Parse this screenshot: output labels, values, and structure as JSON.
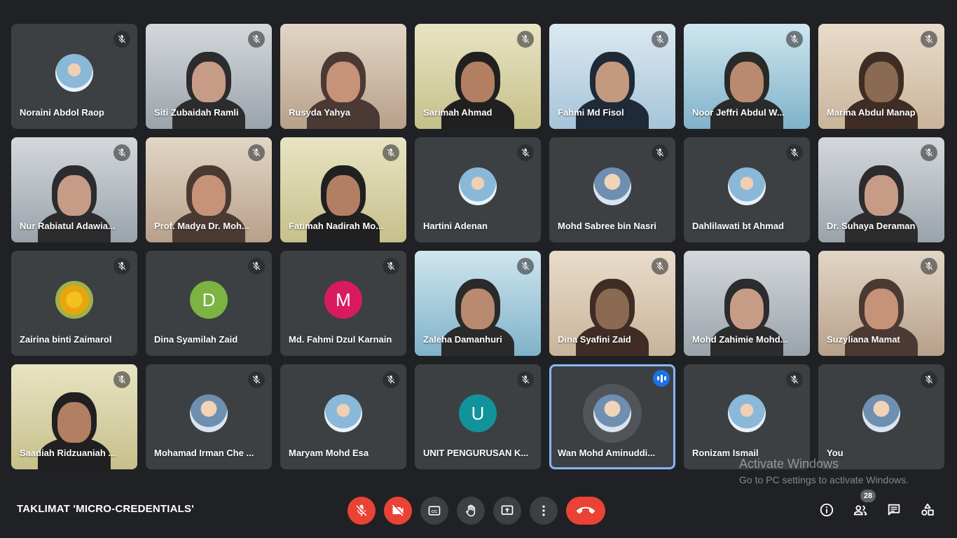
{
  "meeting": {
    "title": "TAKLIMAT 'MICRO-CREDENTIALS'",
    "participant_count": "28"
  },
  "watermark": {
    "line1": "Activate Windows",
    "line2": "Go to PC settings to activate Windows."
  },
  "participants": [
    {
      "name": "Noraini Abdol Raop",
      "tile": "avatar",
      "avatar": "photo-hijab",
      "muted": true
    },
    {
      "name": "Siti Zubaidah Ramli",
      "tile": "video",
      "muted": true
    },
    {
      "name": "Rusyda Yahya",
      "tile": "video",
      "muted": false
    },
    {
      "name": "Sarimah Ahmad",
      "tile": "video",
      "muted": true
    },
    {
      "name": "Fahmi Md Fisol",
      "tile": "video",
      "muted": true
    },
    {
      "name": "Noor Jeffri Abdul W...",
      "tile": "video",
      "muted": true
    },
    {
      "name": "Marina Abdul Manap",
      "tile": "video",
      "muted": true
    },
    {
      "name": "Nur Rabiatul Adawia...",
      "tile": "video",
      "muted": true
    },
    {
      "name": "Prof. Madya Dr. Moh...",
      "tile": "video",
      "muted": true
    },
    {
      "name": "Fatimah Nadirah Mo...",
      "tile": "video",
      "muted": true
    },
    {
      "name": "Hartini Adenan",
      "tile": "avatar",
      "avatar": "photo-hijab",
      "muted": true
    },
    {
      "name": "Mohd Sabree bin Nasri",
      "tile": "avatar",
      "avatar": "photo",
      "muted": true
    },
    {
      "name": "Dahlilawati bt Ahmad",
      "tile": "avatar",
      "avatar": "photo-hijab",
      "muted": true
    },
    {
      "name": "Dr. Suhaya Deraman",
      "tile": "video",
      "muted": true
    },
    {
      "name": "Zairina binti Zaimarol",
      "tile": "avatar",
      "avatar": "photo-flower",
      "muted": true
    },
    {
      "name": "Dina Syamilah Zaid",
      "tile": "avatar",
      "avatar": "letter",
      "letter": "D",
      "color": "#7cb342",
      "muted": true
    },
    {
      "name": "Md. Fahmi Dzul Karnain",
      "tile": "avatar",
      "avatar": "letter",
      "letter": "M",
      "color": "#d81b60",
      "muted": true
    },
    {
      "name": "Zaleha Damanhuri",
      "tile": "video",
      "muted": true
    },
    {
      "name": "Dina Syafini Zaid",
      "tile": "video",
      "muted": true
    },
    {
      "name": "Mohd Zahimie Mohd...",
      "tile": "video",
      "muted": false
    },
    {
      "name": "Suzyliana Mamat",
      "tile": "video",
      "muted": true
    },
    {
      "name": "Saadiah Ridzuaniah ...",
      "tile": "video",
      "muted": true
    },
    {
      "name": "Mohamad Irman Che ...",
      "tile": "avatar",
      "avatar": "photo",
      "muted": true
    },
    {
      "name": "Maryam Mohd Esa",
      "tile": "avatar",
      "avatar": "photo-hijab",
      "muted": true
    },
    {
      "name": "UNIT PENGURUSAN K...",
      "tile": "avatar",
      "avatar": "letter",
      "letter": "U",
      "color": "#12939a",
      "muted": true
    },
    {
      "name": "Wan Mohd Aminuddi...",
      "tile": "avatar",
      "avatar": "photo",
      "muted": false,
      "speaking": true
    },
    {
      "name": "Ronizam Ismail",
      "tile": "avatar",
      "avatar": "photo-hijab",
      "muted": true
    },
    {
      "name": "You",
      "tile": "avatar",
      "avatar": "photo",
      "muted": true
    }
  ],
  "controls": {
    "mic": "mic-off-icon",
    "camera": "camera-off-icon",
    "captions": "closed-captions-icon",
    "raise_hand": "raise-hand-icon",
    "present": "present-screen-icon",
    "more": "more-options-icon",
    "leave": "end-call-icon",
    "info": "info-icon",
    "people": "people-icon",
    "chat": "chat-icon",
    "activities": "activities-icon",
    "captions_label": "CC"
  },
  "colors": {
    "background": "#202124",
    "tile": "#3c4043",
    "danger": "#ea4335",
    "speaking": "#8ab4f8"
  }
}
